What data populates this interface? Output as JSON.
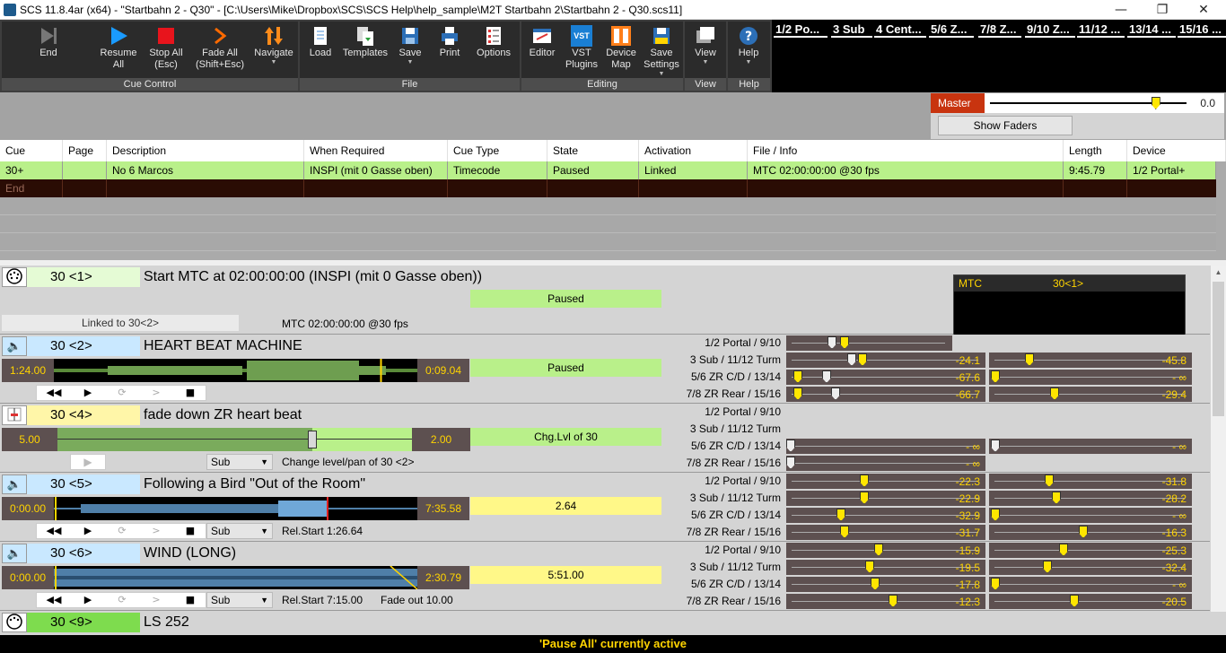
{
  "title_bar": {
    "title": "SCS 11.8.4ar (x64) - \"Startbahn 2 - Q30\" - [C:\\Users\\Mike\\Dropbox\\SCS\\SCS Help\\help_sample\\M2T Startbahn 2\\Startbahn 2 - Q30.scs11]",
    "minimize": "—",
    "restore": "❐",
    "close": "✕"
  },
  "ribbon": {
    "cue_control": {
      "label": "Cue Control",
      "end": "End",
      "resume_all_1": "Resume",
      "resume_all_2": "All",
      "stop_all_1": "Stop All",
      "stop_all_2": "(Esc)",
      "fade_all_1": "Fade All",
      "fade_all_2": "(Shift+Esc)",
      "navigate": "Navigate"
    },
    "file": {
      "label": "File",
      "load": "Load",
      "templates": "Templates",
      "save": "Save",
      "print": "Print",
      "options": "Options"
    },
    "editing": {
      "label": "Editing",
      "editor": "Editor",
      "vst_1": "VST",
      "vst_2": "Plugins",
      "device_map_1": "Device",
      "device_map_2": "Map",
      "save_settings_1": "Save",
      "save_settings_2": "Settings"
    },
    "view": {
      "label": "View",
      "view": "View"
    },
    "help": {
      "label": "Help",
      "help": "Help",
      "vst_badge": "VST"
    }
  },
  "cue_tabs": [
    "1/2 Po...",
    "3 Sub",
    "4 Cent...",
    "5/6 Z...",
    "7/8 Z...",
    "9/10 Z...",
    "11/12 ...",
    "13/14 ...",
    "15/16 ..."
  ],
  "master": {
    "label": "Master",
    "value": "0.0",
    "show_faders": "Show Faders",
    "level": 0.86
  },
  "cue_list": {
    "headers": [
      "Cue",
      "Page",
      "Description",
      "When Required",
      "Cue Type",
      "State",
      "Activation",
      "File / Info",
      "Length",
      "Device"
    ],
    "rows": [
      {
        "cue": "30+",
        "page": "",
        "description": "No 6 Marcos",
        "when": "INSPI (mit 0 Gasse oben)",
        "type": "Timecode",
        "state": "Paused",
        "activation": "Linked",
        "file": "MTC 02:00:00:00 @30 fps",
        "length": "9:45.79",
        "device": "1/2 Portal+"
      },
      {
        "cue": "End"
      }
    ]
  },
  "panels": {
    "p1": {
      "num": "30 <1>",
      "desc": "Start MTC at 02:00:00:00  (INSPI (mit 0 Gasse oben))",
      "state": "Paused",
      "linked": "Linked to 30<2>",
      "info": "MTC 02:00:00:00 @30 fps",
      "mtc_label": "MTC",
      "mtc_cue": "30<1>"
    },
    "p2": {
      "num": "30 <2>",
      "desc": "HEART BEAT MACHINE",
      "time_start": "1:24.00",
      "time_end": "0:09.04",
      "state": "Paused",
      "playhead": 0.9,
      "devices": [
        "1/2 Portal / 9/10",
        "3 Sub / 11/12 Turm",
        "5/6 ZR C/D / 13/14",
        "7/8 ZR Rear / 15/16"
      ],
      "left_vals": [
        "",
        "-24.1",
        "-67.6",
        "-66.7"
      ],
      "right_vals": [
        "",
        "-45.8",
        "- ∞",
        "-29.4"
      ]
    },
    "p3": {
      "num": "30 <4>",
      "desc": "fade down ZR heart beat",
      "level_left": "5.00",
      "level_right": "2.00",
      "state": "Chg.Lvl of 30",
      "sub": "Sub",
      "info": "Change level/pan of 30 <2>",
      "slider": 0.72,
      "devices": [
        "1/2 Portal / 9/10",
        "3 Sub / 11/12 Turm",
        "5/6 ZR C/D / 13/14",
        "7/8 ZR Rear / 15/16"
      ],
      "left_vals": [
        "- ∞",
        "- ∞"
      ],
      "right_vals": [
        "- ∞"
      ]
    },
    "p4": {
      "num": "30 <5>",
      "desc": "Following a Bird \"Out of the Room\"",
      "time_start": "0:00.00",
      "time_end": "7:35.58",
      "state": "2.64",
      "sub": "Sub",
      "info": "Rel.Start 1:26.64",
      "devices": [
        "1/2 Portal / 9/10",
        "3 Sub / 11/12 Turm",
        "5/6 ZR C/D / 13/14",
        "7/8 ZR Rear / 15/16"
      ],
      "left_vals": [
        "-22.3",
        "-22.9",
        "-32.9",
        "-31.7"
      ],
      "right_vals": [
        "-31.8",
        "-28.2",
        "- ∞",
        "-16.3"
      ]
    },
    "p5": {
      "num": "30 <6>",
      "desc": "WIND (LONG)",
      "time_start": "0:00.00",
      "time_end": "2:30.79",
      "state": "5:51.00",
      "sub": "Sub",
      "info": "Rel.Start 7:15.00",
      "fade": "Fade out 10.00",
      "devices": [
        "1/2 Portal / 9/10",
        "3 Sub / 11/12 Turm",
        "5/6 ZR C/D / 13/14",
        "7/8 ZR Rear / 15/16"
      ],
      "left_vals": [
        "-15.9",
        "-19.5",
        "-17.8",
        "-12.3"
      ],
      "right_vals": [
        "-25.3",
        "-32.4",
        "- ∞",
        "-20.5"
      ]
    },
    "p6": {
      "num": "30 <9>",
      "desc": "LS 252"
    }
  },
  "controls": {
    "rewind": "◀◀",
    "play": "▶",
    "loop": "⟳",
    "fwd": ">",
    "stop": "■"
  },
  "status": "'Pause All' currently active",
  "colors": {
    "ribbon": "#2b2b2b",
    "green_state": "#b9f08a",
    "yellow_state": "#fff888",
    "time_bg": "#5d5050",
    "accent_red": "#c8340f"
  }
}
